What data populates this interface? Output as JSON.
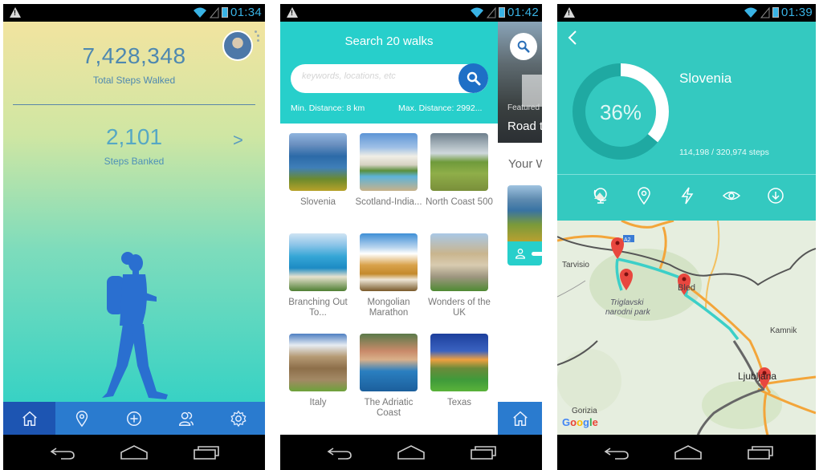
{
  "screens": [
    {
      "status": {
        "time": "01:34"
      },
      "dashboard": {
        "total_steps": "7,428,348",
        "total_steps_label": "Total Steps Walked",
        "banked_steps": "2,101",
        "banked_steps_label": "Steps Banked",
        "chevron": ">"
      },
      "tabs": [
        {
          "name": "home",
          "icon": "home-icon",
          "active": true
        },
        {
          "name": "walks",
          "icon": "map-pin-icon",
          "active": false
        },
        {
          "name": "add",
          "icon": "plus-circle-icon",
          "active": false
        },
        {
          "name": "friends",
          "icon": "users-icon",
          "active": false
        },
        {
          "name": "settings",
          "icon": "gear-icon",
          "active": false
        }
      ]
    },
    {
      "status": {
        "time": "01:42"
      },
      "search": {
        "title": "Search 20 walks",
        "placeholder": "keywords, locations, etc",
        "value": "",
        "min_distance": "Min. Distance: 8 km",
        "max_distance": "Max. Distance: 2992..."
      },
      "featured": {
        "label": "Featured",
        "title": "Road t"
      },
      "your_walks_label": "Your W",
      "walks": [
        {
          "name": "Slovenia"
        },
        {
          "name": "Scotland-India..."
        },
        {
          "name": "North Coast 500"
        },
        {
          "name": "Branching Out To..."
        },
        {
          "name": "Mongolian Marathon"
        },
        {
          "name": "Wonders of the UK"
        },
        {
          "name": "Italy"
        },
        {
          "name": "The Adriatic Coast"
        },
        {
          "name": "Texas"
        }
      ]
    },
    {
      "status": {
        "time": "01:39"
      },
      "walk": {
        "name": "Slovenia",
        "percent": 36,
        "percent_label": "36%",
        "steps_progress": "114,198 / 320,974 steps"
      },
      "detail_tabs": [
        {
          "icon": "globe-icon",
          "active": true
        },
        {
          "icon": "map-pin-icon",
          "active": false
        },
        {
          "icon": "lightning-icon",
          "active": false
        },
        {
          "icon": "eye-icon",
          "active": false
        },
        {
          "icon": "download-icon",
          "active": false
        }
      ],
      "map": {
        "labels": [
          "Tarvisio",
          "Triglavski",
          "narodni park",
          "Bled",
          "Kamnik",
          "Ljubljana",
          "Gorizia"
        ],
        "road_badge": "A2",
        "attribution": "Google"
      }
    }
  ]
}
